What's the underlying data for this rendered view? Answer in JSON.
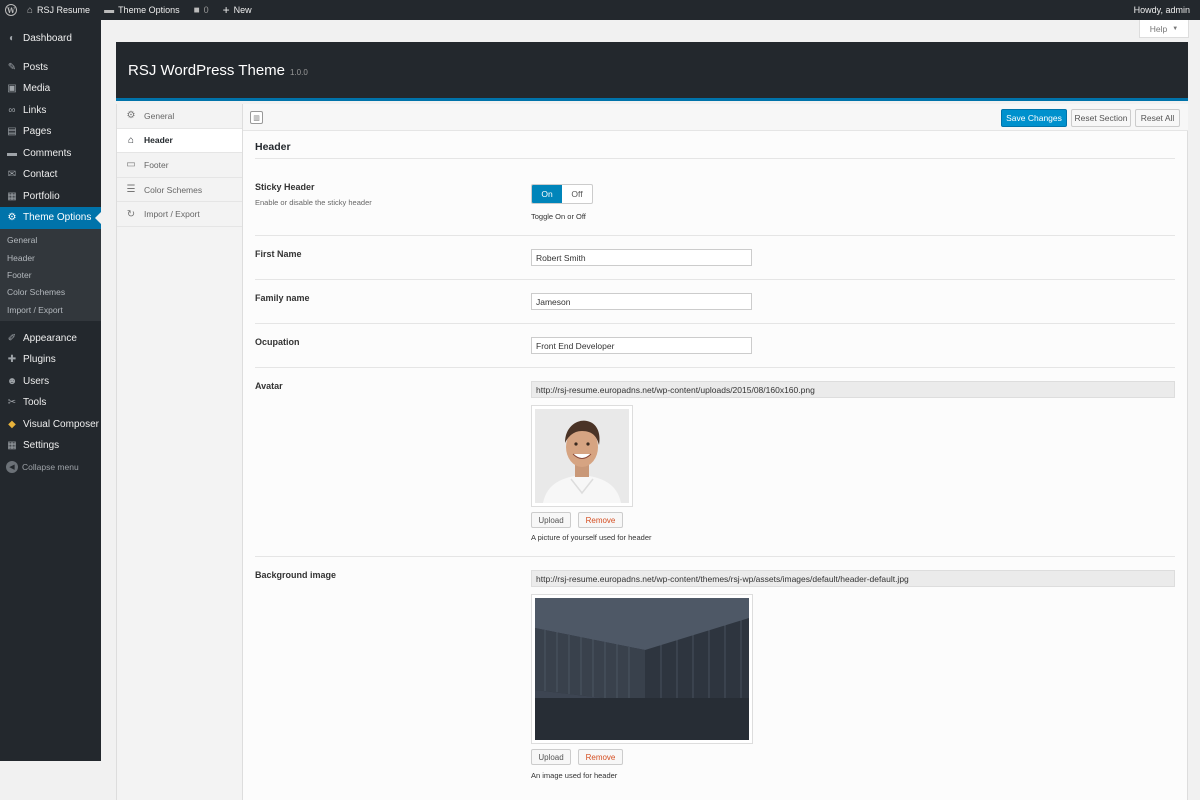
{
  "admin_bar": {
    "site_name": "RSJ Resume",
    "theme_options": "Theme Options",
    "comments_count": "0",
    "new_label": "New",
    "greeting": "Howdy, admin"
  },
  "admin_menu": {
    "items": [
      {
        "label": "Dashboard",
        "icon": "dashboard-icon"
      },
      {
        "label": "Posts",
        "icon": "pin-icon"
      },
      {
        "label": "Media",
        "icon": "media-icon"
      },
      {
        "label": "Links",
        "icon": "link-icon"
      },
      {
        "label": "Pages",
        "icon": "pages-icon"
      },
      {
        "label": "Comments",
        "icon": "comment-icon"
      },
      {
        "label": "Contact",
        "icon": "mail-icon"
      },
      {
        "label": "Portfolio",
        "icon": "portfolio-icon"
      },
      {
        "label": "Theme Options",
        "icon": "gear-icon"
      }
    ],
    "submenu": [
      "General",
      "Header",
      "Footer",
      "Color Schemes",
      "Import / Export"
    ],
    "items_after": [
      {
        "label": "Appearance",
        "icon": "brush-icon"
      },
      {
        "label": "Plugins",
        "icon": "plugin-icon"
      },
      {
        "label": "Users",
        "icon": "users-icon"
      },
      {
        "label": "Tools",
        "icon": "wrench-icon"
      },
      {
        "label": "Visual Composer",
        "icon": "composer-icon"
      },
      {
        "label": "Settings",
        "icon": "settings-icon"
      }
    ],
    "collapse_label": "Collapse menu"
  },
  "help_tab": "Help",
  "panel": {
    "title": "RSJ WordPress Theme",
    "version": "1.0.0"
  },
  "options_sidebar": [
    {
      "label": "General",
      "icon": "cogs-icon"
    },
    {
      "label": "Header",
      "icon": "home-icon"
    },
    {
      "label": "Footer",
      "icon": "footer-icon"
    },
    {
      "label": "Color Schemes",
      "icon": "list-icon"
    },
    {
      "label": "Import / Export",
      "icon": "refresh-icon"
    }
  ],
  "toolbar": {
    "save": "Save Changes",
    "reset_section": "Reset Section",
    "reset_all": "Reset All"
  },
  "section": {
    "title": "Header",
    "sticky": {
      "label": "Sticky Header",
      "desc": "Enable or disable the sticky header",
      "on": "On",
      "off": "Off",
      "value": "On",
      "help": "Toggle On or Off"
    },
    "first_name": {
      "label": "First Name",
      "value": "Robert Smith"
    },
    "family_name": {
      "label": "Family name",
      "value": "Jameson"
    },
    "occupation": {
      "label": "Ocupation",
      "value": "Front End Developer"
    },
    "avatar": {
      "label": "Avatar",
      "url": "http://rsj-resume.europadns.net/wp-content/uploads/2015/08/160x160.png",
      "upload": "Upload",
      "remove": "Remove",
      "desc": "A picture of yourself used for header"
    },
    "background": {
      "label": "Background image",
      "url": "http://rsj-resume.europadns.net/wp-content/themes/rsj-wp/assets/images/default/header-default.jpg",
      "upload": "Upload",
      "remove": "Remove",
      "desc": "An image used for header"
    }
  }
}
